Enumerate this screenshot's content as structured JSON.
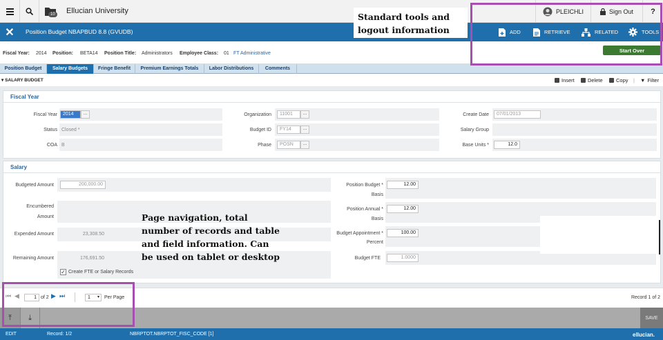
{
  "topbar": {
    "app_title": "Ellucian University",
    "recent_count": "10",
    "username": "PLEICHLI",
    "signout_label": "Sign Out",
    "help_label": "?"
  },
  "pagebar": {
    "page_name": "Position Budget NBAPBUD 8.8 (GVUDB)",
    "tools": {
      "add": "ADD",
      "retrieve": "RETRIEVE",
      "related": "RELATED",
      "tools": "TOOLS"
    }
  },
  "keyblock": {
    "fiscal_year_label": "Fiscal Year:",
    "fiscal_year": "2014",
    "position_label": "Position:",
    "position": "BETA14",
    "position_title_label": "Position Title:",
    "position_title": "Administrators",
    "employee_class_label": "Employee Class:",
    "employee_class_code": "01",
    "employee_class_desc": "FT Administrative",
    "start_over": "Start Over"
  },
  "tabs": [
    {
      "label": "Position Budget"
    },
    {
      "label": "Salary Budgets"
    },
    {
      "label": "Fringe Benefit"
    },
    {
      "label": "Premium Earnings Totals"
    },
    {
      "label": "Labor Distributions"
    },
    {
      "label": "Comments"
    }
  ],
  "section": {
    "title": "SALARY BUDGET",
    "insert": "Insert",
    "delete": "Delete",
    "copy": "Copy",
    "filter": "Filter"
  },
  "fiscal_panel": {
    "title": "Fiscal Year",
    "fiscal_year_label": "Fiscal Year",
    "fiscal_year": "2014",
    "status_label": "Status",
    "status": "Closed *",
    "coa_label": "COA",
    "coa": "B",
    "organization_label": "Organization",
    "organization": "11001",
    "budget_id_label": "Budget ID",
    "budget_id": "FY14",
    "phase_label": "Phase",
    "phase": "POSN",
    "create_date_label": "Create Date",
    "create_date": "07/01/2013",
    "salary_group_label": "Salary Group",
    "base_units_label": "Base Units *",
    "base_units": "12.0"
  },
  "salary_panel": {
    "title": "Salary",
    "budgeted_amount_label": "Budgeted Amount",
    "budgeted_amount": "200,000.00",
    "encumbered_label_1": "Encumbered",
    "encumbered_label_2": "Amount",
    "expended_label": "Expended Amount",
    "expended": "23,308.50",
    "remaining_label": "Remaining Amount",
    "remaining": "176,691.50",
    "create_fte_label": "Create FTE or Salary Records",
    "position_budget_label": "Position Budget *",
    "position_budget": "12.00",
    "basis_label": "Basis",
    "position_annual_label": "Position Annual *",
    "position_annual": "12.00",
    "basis_label_2": "Basis",
    "budget_appt_label_1": "Budget Appointment *",
    "budget_appt_label_2": "Percent",
    "budget_appt": "100.00",
    "budget_fte_label": "Budget FTE",
    "budget_fte": "1.0000"
  },
  "annotations": {
    "tools_line1": "Standard tools and",
    "tools_line2": "logout information",
    "nav_line1": "Page navigation, total",
    "nav_line2": "number of records and table",
    "nav_line3": "and field information. Can",
    "nav_line4": "be used on tablet or desktop"
  },
  "pager": {
    "page": "1",
    "of_label": "of 2",
    "per_page": "1",
    "per_page_label": "Per Page",
    "record_label": "Record 1 of 2",
    "save": "SAVE"
  },
  "status": {
    "mode": "EDIT",
    "record": "Record: 1/2",
    "field": "NBRPTOT.NBRPTOT_FISC_CODE [1]",
    "brand": "ellucian."
  },
  "colors": {
    "brand_blue": "#1f6fad",
    "annotation_border": "#a64fb0",
    "start_over_green": "#3c7a32"
  }
}
